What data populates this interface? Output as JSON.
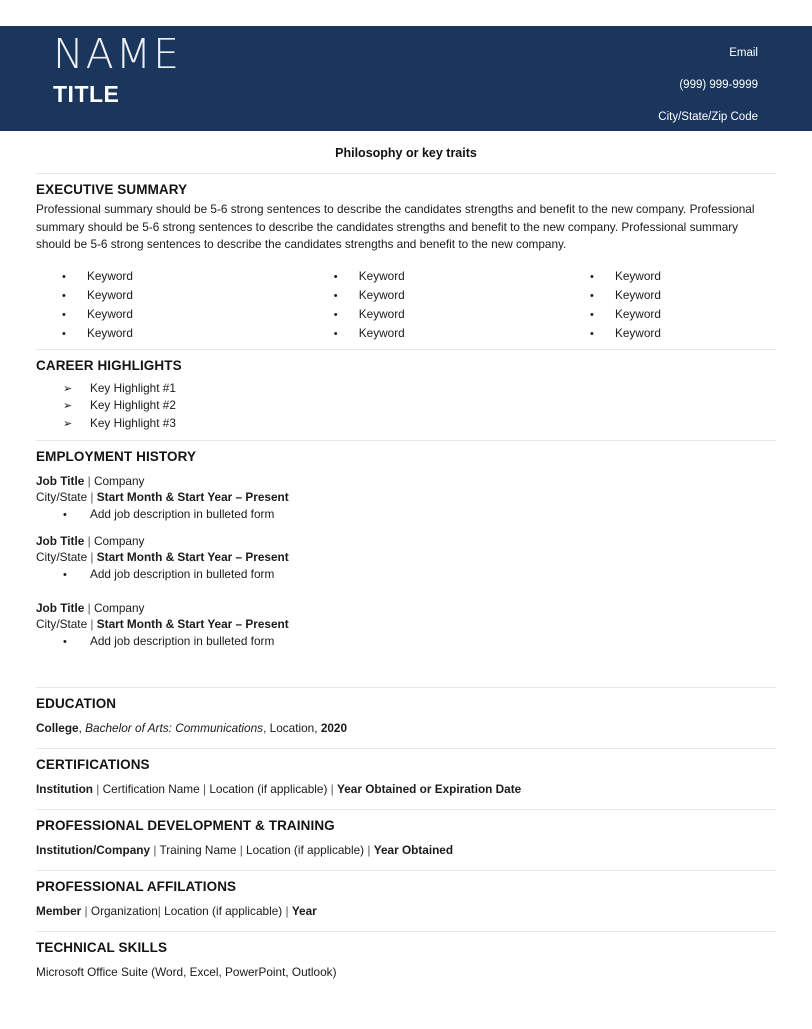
{
  "theme": {
    "banner_color": "#1b365d",
    "divider_color": "#e7e7e7",
    "text_color": "#1b1b1b"
  },
  "header": {
    "name": "NAME",
    "title": "TITLE",
    "contact": {
      "email": "Email",
      "phone": "(999) 999-9999",
      "address": "City/State/Zip Code"
    }
  },
  "tagline": "Philosophy or key traits",
  "sections": {
    "executive_summary": {
      "heading": "EXECUTIVE SUMMARY",
      "paragraph": "Professional summary should be 5-6 strong sentences to describe the candidates strengths and benefit to the new company. Professional summary should be 5-6 strong sentences to describe the candidates strengths and benefit to the new company. Professional summary should be 5-6 strong sentences to describe the candidates strengths and benefit to the new company."
    },
    "keywords": {
      "bullet_glyph": "•",
      "columns": [
        [
          "Keyword",
          "Keyword",
          "Keyword",
          "Keyword"
        ],
        [
          "Keyword",
          "Keyword",
          "Keyword",
          "Keyword"
        ],
        [
          "Keyword",
          "Keyword",
          "Keyword",
          "Keyword"
        ]
      ]
    },
    "career_highlights": {
      "heading": "CAREER HIGHLIGHTS",
      "arrow_glyph": "➢",
      "items": [
        "Key Highlight #1",
        "Key Highlight #2",
        "Key Highlight #3"
      ]
    },
    "employment_history": {
      "heading": "EMPLOYMENT HISTORY",
      "jobs": [
        {
          "job_title": "Job Title",
          "separator": "|",
          "company": "Company",
          "location": "City/State",
          "dates": "Start Month & Start Year – Present",
          "bullet_glyph": "•",
          "bullets": [
            "Add job description in bulleted form"
          ]
        },
        {
          "job_title": "Job Title",
          "separator": "|",
          "company": "Company",
          "location": "City/State",
          "dates": "Start Month & Start Year – Present",
          "bullet_glyph": "•",
          "bullets": [
            "Add job description in bulleted form"
          ]
        },
        {
          "job_title": "Job Title",
          "separator": "|",
          "company": "Company",
          "location": "City/State",
          "dates": "Start Month & Start Year – Present",
          "bullet_glyph": "•",
          "bullets": [
            "Add job description in bulleted form"
          ]
        }
      ]
    },
    "education": {
      "heading": "EDUCATION",
      "school": "College",
      "comma1": ",",
      "degree": "Bachelor of Arts: Communications",
      "comma2": ",",
      "location": "Location",
      "comma3": ",",
      "year": "2020"
    },
    "certifications": {
      "heading": "CERTIFICATIONS",
      "institution": "Institution",
      "sep1": "|",
      "certification_name": "Certification Name",
      "sep2": "|",
      "location": "Location (if applicable)",
      "sep3": "|",
      "year": "Year Obtained or Expiration Date"
    },
    "professional_development": {
      "heading": "PROFESSIONAL DEVELOPMENT & TRAINING",
      "institution": "Institution/Company",
      "sep1": "|",
      "training_name": "Training Name",
      "sep2": "|",
      "location": "Location (if applicable)",
      "sep3": "|",
      "year": "Year Obtained"
    },
    "professional_affiliations": {
      "heading": "PROFESSIONAL AFFILATIONS",
      "member": "Member",
      "sep1": "|",
      "organization": "Organization",
      "sep2": "|",
      "location": "Location (if applicable)",
      "sep3": "|",
      "year": "Year"
    },
    "technical_skills": {
      "heading": "TECHNICAL SKILLS",
      "content": "Microsoft Office Suite (Word, Excel, PowerPoint, Outlook)"
    }
  }
}
